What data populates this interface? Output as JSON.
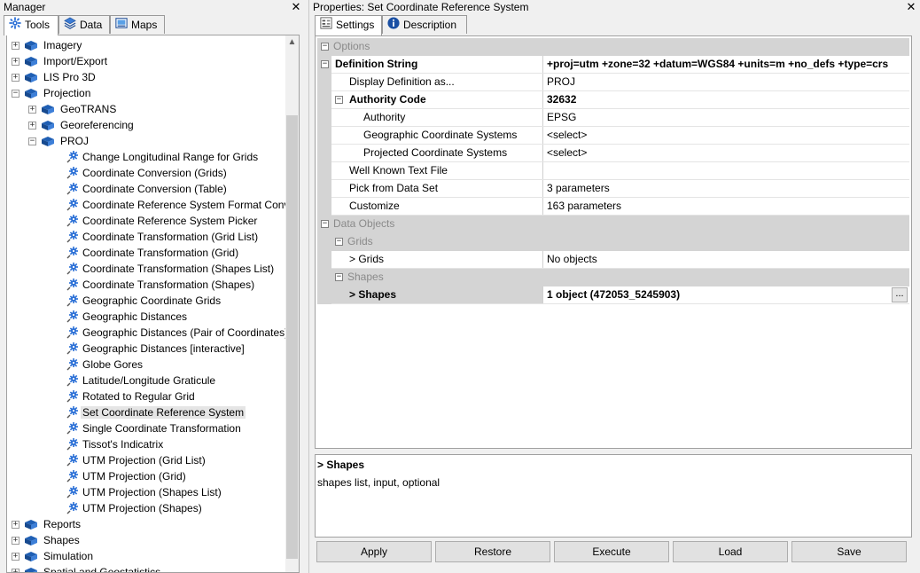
{
  "manager": {
    "title": "Manager",
    "close": "✕",
    "tabs": [
      {
        "label": "Tools",
        "icon": "gear-icon"
      },
      {
        "label": "Data",
        "icon": "layers-icon"
      },
      {
        "label": "Maps",
        "icon": "map-icon"
      }
    ],
    "tree": [
      {
        "label": "Imagery",
        "level": 0,
        "kind": "folder",
        "expander": "+"
      },
      {
        "label": "Import/Export",
        "level": 0,
        "kind": "folder",
        "expander": "+"
      },
      {
        "label": "LIS Pro 3D",
        "level": 0,
        "kind": "folder",
        "expander": "+"
      },
      {
        "label": "Projection",
        "level": 0,
        "kind": "folder",
        "expander": "−"
      },
      {
        "label": "GeoTRANS",
        "level": 1,
        "kind": "folder",
        "expander": "+"
      },
      {
        "label": "Georeferencing",
        "level": 1,
        "kind": "folder",
        "expander": "+"
      },
      {
        "label": "PROJ",
        "level": 1,
        "kind": "folder",
        "expander": "−"
      },
      {
        "label": "Change Longitudinal Range for Grids",
        "level": 2,
        "kind": "tool"
      },
      {
        "label": "Coordinate Conversion (Grids)",
        "level": 2,
        "kind": "tool"
      },
      {
        "label": "Coordinate Conversion (Table)",
        "level": 2,
        "kind": "tool"
      },
      {
        "label": "Coordinate Reference System Format Conve",
        "level": 2,
        "kind": "tool"
      },
      {
        "label": "Coordinate Reference System Picker",
        "level": 2,
        "kind": "tool"
      },
      {
        "label": "Coordinate Transformation (Grid List)",
        "level": 2,
        "kind": "tool"
      },
      {
        "label": "Coordinate Transformation (Grid)",
        "level": 2,
        "kind": "tool"
      },
      {
        "label": "Coordinate Transformation (Shapes List)",
        "level": 2,
        "kind": "tool"
      },
      {
        "label": "Coordinate Transformation (Shapes)",
        "level": 2,
        "kind": "tool"
      },
      {
        "label": "Geographic Coordinate Grids",
        "level": 2,
        "kind": "tool"
      },
      {
        "label": "Geographic Distances",
        "level": 2,
        "kind": "tool"
      },
      {
        "label": "Geographic Distances (Pair of Coordinates)",
        "level": 2,
        "kind": "tool"
      },
      {
        "label": "Geographic Distances [interactive]",
        "level": 2,
        "kind": "tool"
      },
      {
        "label": "Globe Gores",
        "level": 2,
        "kind": "tool"
      },
      {
        "label": "Latitude/Longitude Graticule",
        "level": 2,
        "kind": "tool"
      },
      {
        "label": "Rotated to Regular Grid",
        "level": 2,
        "kind": "tool"
      },
      {
        "label": "Set Coordinate Reference System",
        "level": 2,
        "kind": "tool",
        "selected": true
      },
      {
        "label": "Single Coordinate Transformation",
        "level": 2,
        "kind": "tool"
      },
      {
        "label": "Tissot's Indicatrix",
        "level": 2,
        "kind": "tool"
      },
      {
        "label": "UTM Projection (Grid List)",
        "level": 2,
        "kind": "tool"
      },
      {
        "label": "UTM Projection (Grid)",
        "level": 2,
        "kind": "tool"
      },
      {
        "label": "UTM Projection (Shapes List)",
        "level": 2,
        "kind": "tool"
      },
      {
        "label": "UTM Projection (Shapes)",
        "level": 2,
        "kind": "tool"
      },
      {
        "label": "Reports",
        "level": 0,
        "kind": "folder",
        "expander": "+"
      },
      {
        "label": "Shapes",
        "level": 0,
        "kind": "folder",
        "expander": "+"
      },
      {
        "label": "Simulation",
        "level": 0,
        "kind": "folder",
        "expander": "+"
      },
      {
        "label": "Spatial and Geostatistics",
        "level": 0,
        "kind": "folder",
        "expander": "+"
      }
    ],
    "scroll_up": "▲",
    "scroll_position": 0.05
  },
  "properties": {
    "title": "Properties: Set Coordinate Reference System",
    "close": "✕",
    "tabs": [
      {
        "label": "Settings",
        "icon": "settings-icon"
      },
      {
        "label": "Description",
        "icon": "info-icon"
      }
    ],
    "rows": [
      {
        "type": "header",
        "name": "Options",
        "indent": 0,
        "expander": "−"
      },
      {
        "type": "data",
        "name": "Definition String",
        "value": "+proj=utm +zone=32 +datum=WGS84 +units=m +no_defs +type=crs",
        "indent": 0,
        "bold": true,
        "expander": "−"
      },
      {
        "type": "data",
        "name": "Display Definition as...",
        "value": "PROJ",
        "indent": 1
      },
      {
        "type": "data",
        "name": "Authority Code",
        "value": "32632",
        "indent": 1,
        "bold": true,
        "expander": "−"
      },
      {
        "type": "data",
        "name": "Authority",
        "value": "EPSG",
        "indent": 2
      },
      {
        "type": "data",
        "name": "Geographic Coordinate Systems",
        "value": "<select>",
        "indent": 2
      },
      {
        "type": "data",
        "name": "Projected Coordinate Systems",
        "value": "<select>",
        "indent": 2
      },
      {
        "type": "data",
        "name": "Well Known Text File",
        "value": "",
        "indent": 1
      },
      {
        "type": "data",
        "name": "Pick from Data Set",
        "value": "3 parameters",
        "indent": 1
      },
      {
        "type": "data",
        "name": "Customize",
        "value": "163 parameters",
        "indent": 1
      },
      {
        "type": "header",
        "name": "Data Objects",
        "indent": 0,
        "expander": "−"
      },
      {
        "type": "header",
        "name": "Grids",
        "indent": 1,
        "expander": "−"
      },
      {
        "type": "data",
        "name": "> Grids",
        "value": "No objects",
        "indent": 1
      },
      {
        "type": "header",
        "name": "Shapes",
        "indent": 1,
        "expander": "−"
      },
      {
        "type": "data",
        "name": "> Shapes",
        "value": "1 object (472053_5245903)",
        "indent": 1,
        "bold": true,
        "selected": true,
        "button": "..."
      }
    ],
    "description": {
      "title": "> Shapes",
      "text": "shapes list, input, optional"
    },
    "buttons": [
      "Apply",
      "Restore",
      "Execute",
      "Load",
      "Save"
    ]
  },
  "colors": {
    "folder_icon": "#1f5fb4",
    "tool_icon": "#2a6fd6",
    "header_bg": "#d4d4d4"
  }
}
